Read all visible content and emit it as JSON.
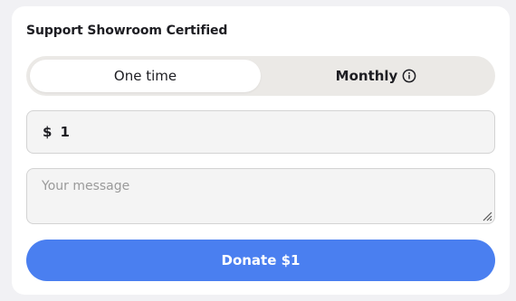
{
  "widget": {
    "title": "Support Showroom Certified"
  },
  "frequency": {
    "options": [
      {
        "label": "One time",
        "selected": true
      },
      {
        "label": "Monthly",
        "selected": false,
        "icon": "info-icon"
      }
    ]
  },
  "amount": {
    "currency_symbol": "$",
    "value": "1"
  },
  "message": {
    "placeholder": "Your message"
  },
  "donate_button": {
    "label": "Donate $1"
  },
  "colors": {
    "accent": "#4a7ff0",
    "toggle_bg": "#ebe9e6",
    "input_bg": "#f4f4f4",
    "input_border": "#d3d3d3",
    "page_bg": "#f1f1f4"
  }
}
